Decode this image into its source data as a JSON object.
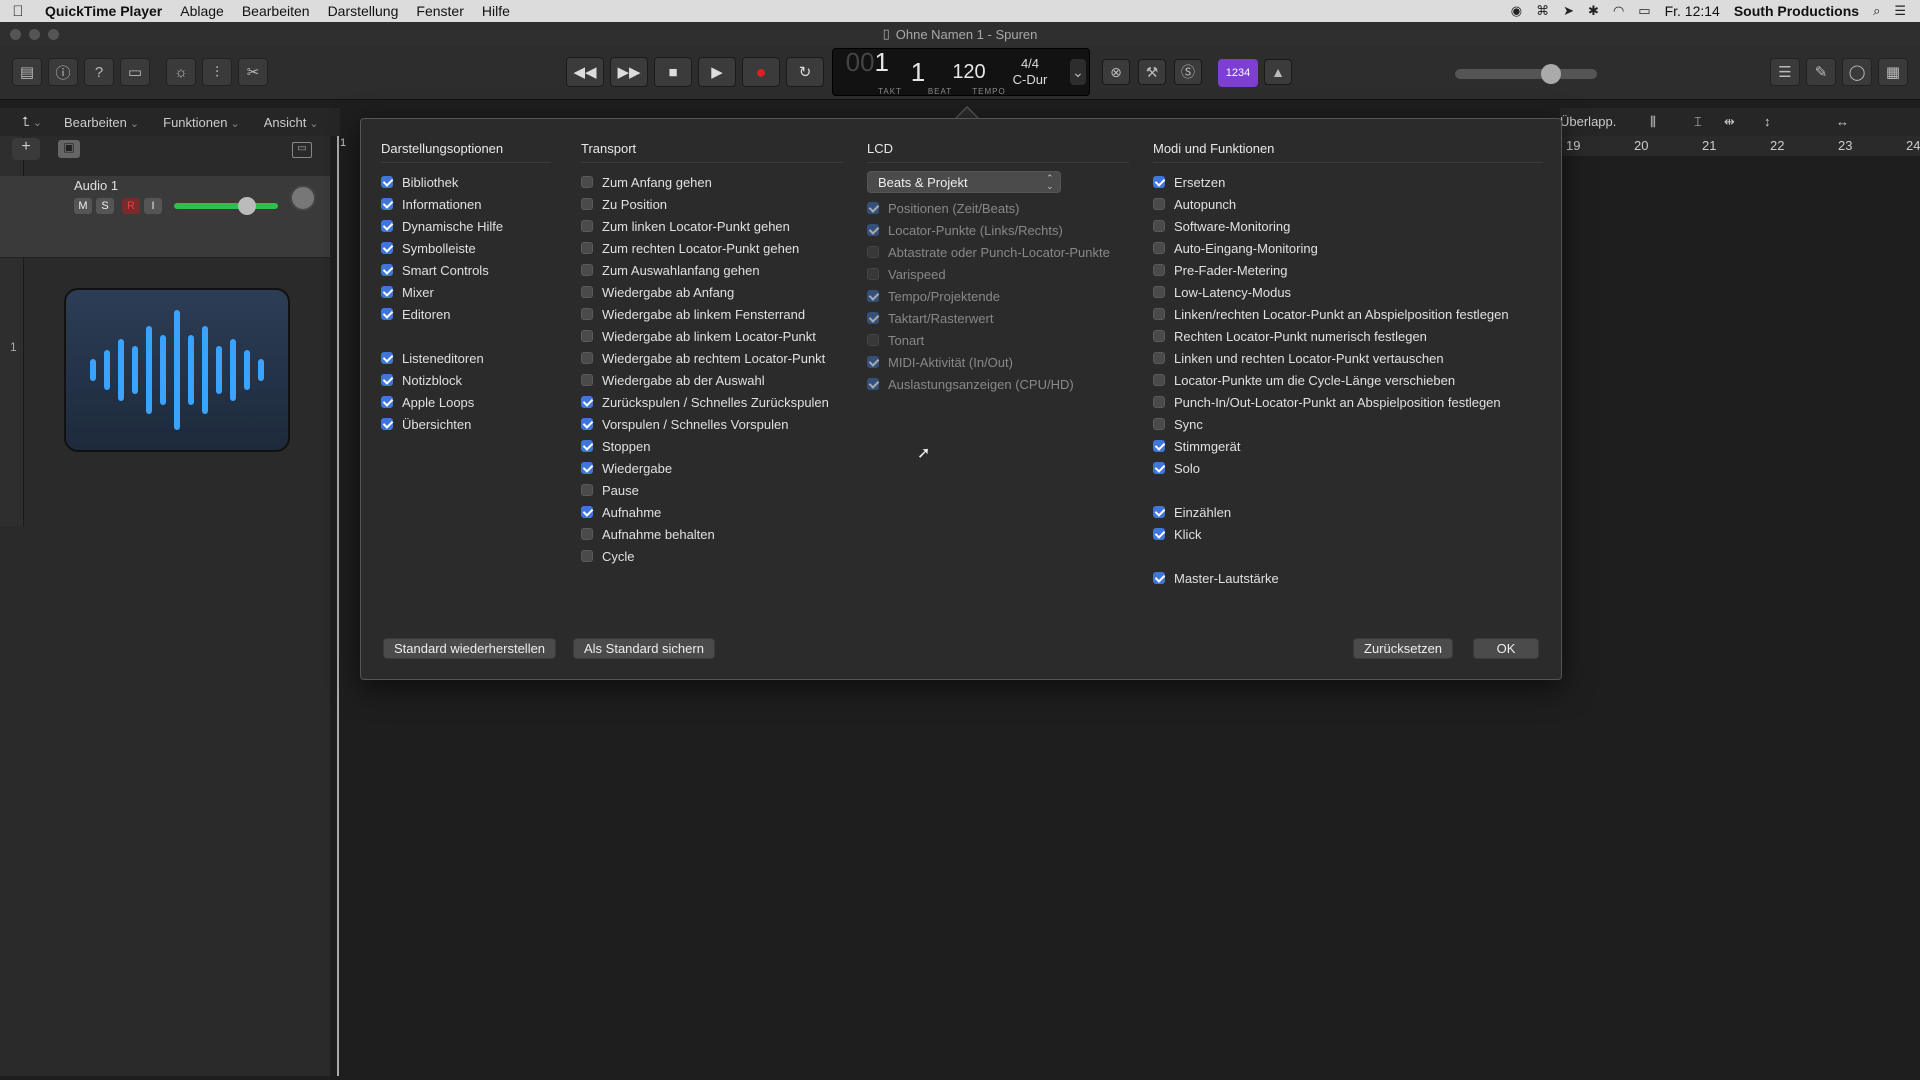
{
  "menubar": {
    "apple": "",
    "app": "QuickTime Player",
    "items": [
      "Ablage",
      "Bearbeiten",
      "Darstellung",
      "Fenster",
      "Hilfe"
    ],
    "clock": "Fr. 12:14",
    "user": "South Productions"
  },
  "window": {
    "title": "Ohne Namen 1 - Spuren"
  },
  "lcd": {
    "bar_dim": "00",
    "bar": "1",
    "beat": "1",
    "tempo": "120",
    "signature": "4/4",
    "key": "C-Dur",
    "bar_label": "TAKT",
    "beat_label": "BEAT",
    "tempo_label": "TEMPO"
  },
  "counter_label": "1234",
  "secondbar": {
    "items": [
      "Bearbeiten",
      "Funktionen",
      "Ansicht"
    ]
  },
  "rightbar": {
    "snap": "Überlapp."
  },
  "track": {
    "number": "1",
    "name": "Audio 1",
    "mute": "M",
    "solo": "S",
    "rec": "R",
    "input": "I"
  },
  "ruler": {
    "marks": [
      "19",
      "20",
      "21",
      "22",
      "23",
      "24"
    ],
    "start": "1"
  },
  "dialog": {
    "columns": [
      {
        "title": "Darstellungsoptionen",
        "items": [
          {
            "label": "Bibliothek",
            "checked": true
          },
          {
            "label": "Informationen",
            "checked": true
          },
          {
            "label": "Dynamische Hilfe",
            "checked": true
          },
          {
            "label": "Symbolleiste",
            "checked": true
          },
          {
            "label": "Smart Controls",
            "checked": true
          },
          {
            "label": "Mixer",
            "checked": true
          },
          {
            "label": "Editoren",
            "checked": true
          },
          {
            "label": "Listeneditoren",
            "checked": true,
            "gap": true
          },
          {
            "label": "Notizblock",
            "checked": true
          },
          {
            "label": "Apple Loops",
            "checked": true
          },
          {
            "label": "Übersichten",
            "checked": true
          }
        ]
      },
      {
        "title": "Transport",
        "items": [
          {
            "label": "Zum Anfang gehen",
            "checked": false
          },
          {
            "label": "Zu Position",
            "checked": false
          },
          {
            "label": "Zum linken Locator-Punkt gehen",
            "checked": false
          },
          {
            "label": "Zum rechten Locator-Punkt gehen",
            "checked": false
          },
          {
            "label": "Zum Auswahlanfang gehen",
            "checked": false
          },
          {
            "label": "Wiedergabe ab Anfang",
            "checked": false
          },
          {
            "label": "Wiedergabe ab linkem Fensterrand",
            "checked": false
          },
          {
            "label": "Wiedergabe ab linkem Locator-Punkt",
            "checked": false
          },
          {
            "label": "Wiedergabe ab rechtem Locator-Punkt",
            "checked": false
          },
          {
            "label": "Wiedergabe ab der Auswahl",
            "checked": false
          },
          {
            "label": "Zurückspulen / Schnelles Zurückspulen",
            "checked": true
          },
          {
            "label": "Vorspulen / Schnelles Vorspulen",
            "checked": true
          },
          {
            "label": "Stoppen",
            "checked": true
          },
          {
            "label": "Wiedergabe",
            "checked": true
          },
          {
            "label": "Pause",
            "checked": false
          },
          {
            "label": "Aufnahme",
            "checked": true
          },
          {
            "label": "Aufnahme behalten",
            "checked": false
          },
          {
            "label": "Cycle",
            "checked": false
          }
        ]
      },
      {
        "title": "LCD",
        "select": "Beats & Projekt",
        "items": [
          {
            "label": "Positionen (Zeit/Beats)",
            "checked": true
          },
          {
            "label": "Locator-Punkte (Links/Rechts)",
            "checked": true
          },
          {
            "label": "Abtastrate oder Punch-Locator-Punkte",
            "checked": false
          },
          {
            "label": "Varispeed",
            "checked": false
          },
          {
            "label": "Tempo/Projektende",
            "checked": true
          },
          {
            "label": "Taktart/Rasterwert",
            "checked": true
          },
          {
            "label": "Tonart",
            "checked": false
          },
          {
            "label": "MIDI-Aktivität (In/Out)",
            "checked": true
          },
          {
            "label": "Auslastungsanzeigen (CPU/HD)",
            "checked": true
          }
        ]
      },
      {
        "title": "Modi und Funktionen",
        "items": [
          {
            "label": "Ersetzen",
            "checked": true
          },
          {
            "label": "Autopunch",
            "checked": false
          },
          {
            "label": "Software-Monitoring",
            "checked": false
          },
          {
            "label": "Auto-Eingang-Monitoring",
            "checked": false
          },
          {
            "label": "Pre-Fader-Metering",
            "checked": false
          },
          {
            "label": "Low-Latency-Modus",
            "checked": false
          },
          {
            "label": "Linken/rechten Locator-Punkt an Abspielposition festlegen",
            "checked": false
          },
          {
            "label": "Rechten Locator-Punkt numerisch festlegen",
            "checked": false
          },
          {
            "label": "Linken und rechten Locator-Punkt vertauschen",
            "checked": false
          },
          {
            "label": "Locator-Punkte um die Cycle-Länge verschieben",
            "checked": false
          },
          {
            "label": "Punch-In/Out-Locator-Punkt an Abspielposition festlegen",
            "checked": false
          },
          {
            "label": "Sync",
            "checked": false
          },
          {
            "label": "Stimmgerät",
            "checked": true
          },
          {
            "label": "Solo",
            "checked": true
          },
          {
            "label": "Einzählen",
            "checked": true,
            "gap": true
          },
          {
            "label": "Klick",
            "checked": true
          },
          {
            "label": "Master-Lautstärke",
            "checked": true,
            "gap": true
          }
        ]
      }
    ],
    "buttons": {
      "restore_default": "Standard wiederherstellen",
      "save_default": "Als Standard sichern",
      "reset": "Zurücksetzen",
      "ok": "OK"
    }
  }
}
